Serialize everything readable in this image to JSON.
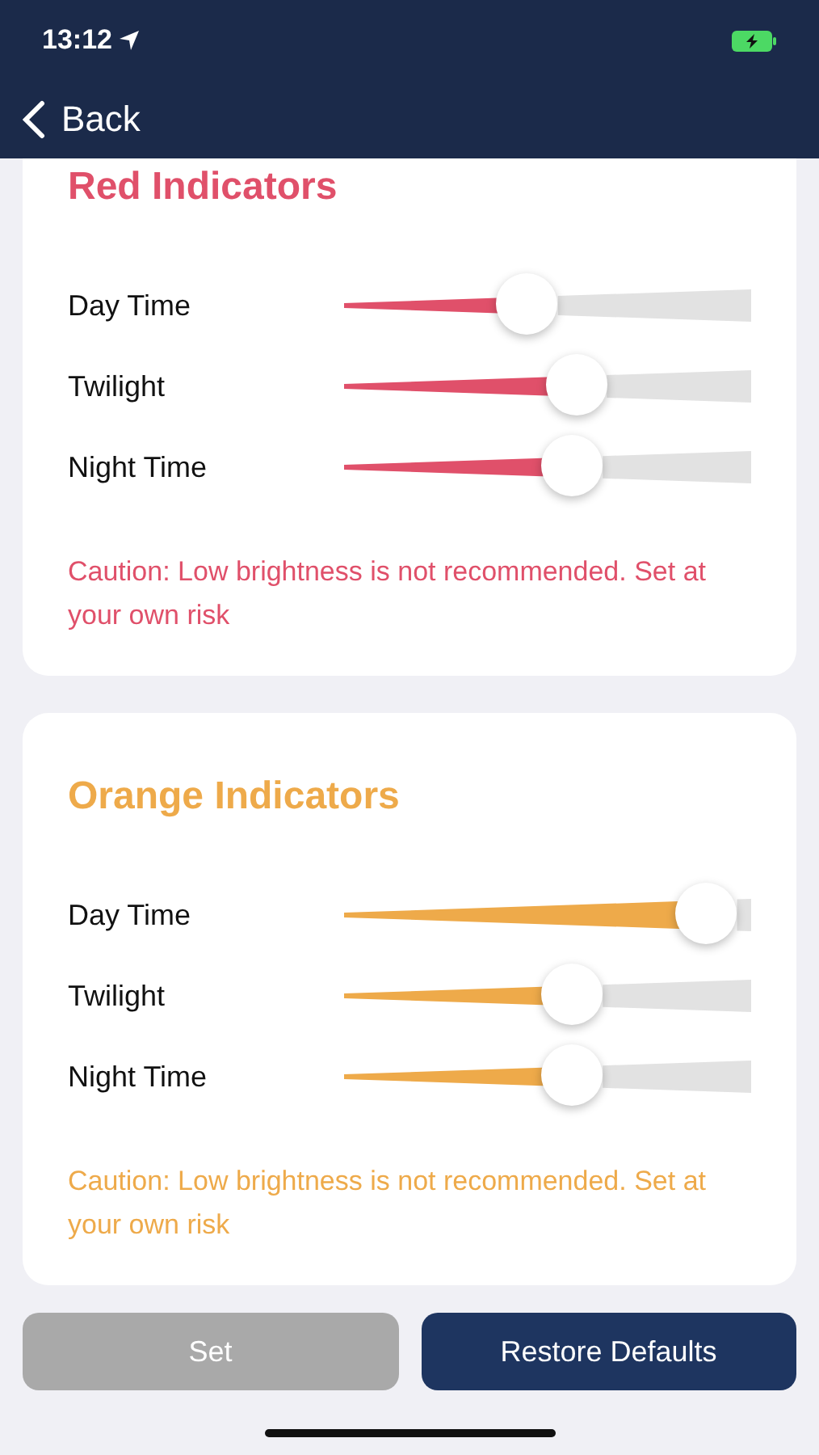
{
  "status_bar": {
    "time": "13:12"
  },
  "nav": {
    "back": "Back"
  },
  "sections": [
    {
      "title": "Red Indicators",
      "color": "#e0506a",
      "sliders": [
        {
          "label": "Day Time",
          "level": 0.45
        },
        {
          "label": "Twilight",
          "level": 0.57
        },
        {
          "label": "Night Time",
          "level": 0.56
        }
      ],
      "caution": "Caution: Low brightness is not recommended. Set at your own risk"
    },
    {
      "title": "Orange Indicators",
      "color": "#eeaa4a",
      "sliders": [
        {
          "label": "Day Time",
          "level": 0.89
        },
        {
          "label": "Twilight",
          "level": 0.56
        },
        {
          "label": "Night Time",
          "level": 0.56
        }
      ],
      "caution": "Caution: Low brightness is not recommended. Set at your own risk"
    }
  ],
  "buttons": [
    {
      "label": "Set",
      "disabled": true
    },
    {
      "label": "Restore Defaults",
      "disabled": false
    }
  ]
}
